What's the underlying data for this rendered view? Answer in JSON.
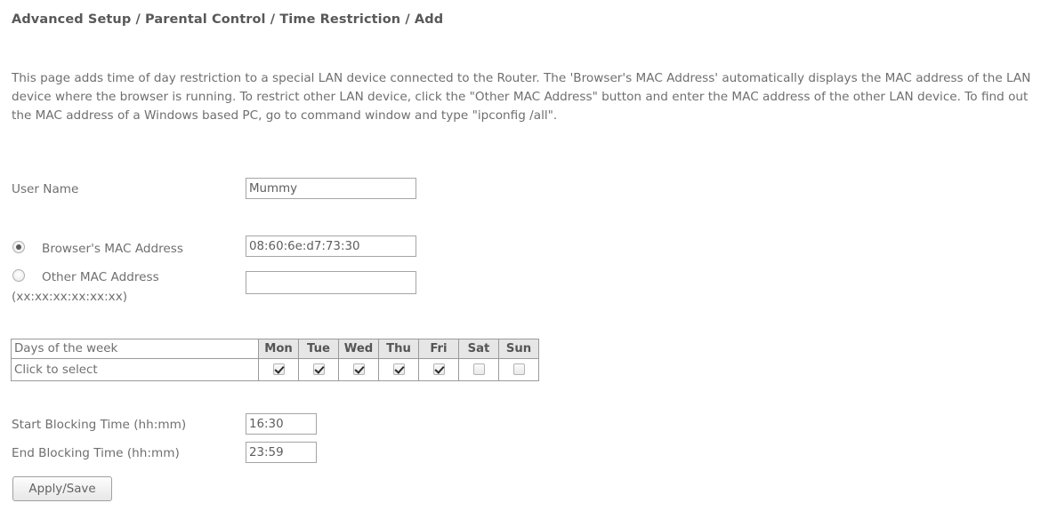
{
  "page": {
    "breadcrumb": "Advanced Setup / Parental Control / Time Restriction / Add",
    "intro": "This page adds time of day restriction to a special LAN device connected to the Router. The 'Browser's MAC Address' automatically displays the MAC address of the LAN device where the browser is running. To restrict other LAN device, click the \"Other MAC Address\" button and enter the MAC address of the other LAN device. To find out the MAC address of a Windows based PC, go to command window and type \"ipconfig /all\"."
  },
  "form": {
    "username_label": "User Name",
    "username_value": "Mummy",
    "browser_mac_label": "Browser's MAC Address",
    "browser_mac_value": "08:60:6e:d7:73:30",
    "other_mac_label": "Other MAC Address",
    "other_mac_value": "",
    "mac_format_hint": "(xx:xx:xx:xx:xx:xx)",
    "mac_source_selected": "browser",
    "start_time_label": "Start Blocking Time (hh:mm)",
    "start_time_value": "16:30",
    "end_time_label": "End Blocking Time (hh:mm)",
    "end_time_value": "23:59",
    "apply_label": "Apply/Save"
  },
  "days_table": {
    "row_header_label": "Days of the week",
    "row_select_label": "Click to select",
    "days": [
      "Mon",
      "Tue",
      "Wed",
      "Thu",
      "Fri",
      "Sat",
      "Sun"
    ],
    "checked": [
      true,
      true,
      true,
      true,
      true,
      false,
      false
    ]
  },
  "colors": {
    "text": "#6f6f6f",
    "title": "#595959",
    "border": "#9a9a9a",
    "header_fill": "#e6e6e6"
  }
}
